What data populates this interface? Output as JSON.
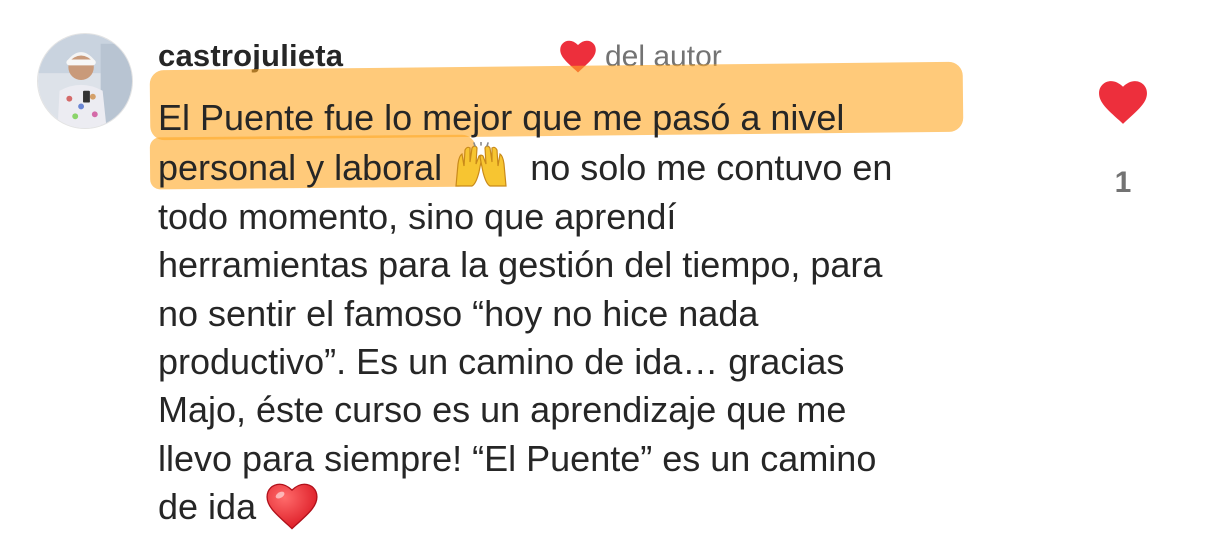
{
  "comment": {
    "username": "castrojulieta",
    "author_like_label": "del autor",
    "lines": [
      "El Puente fue lo mejor que me pasó a nivel",
      "personal y laboral",
      "no solo me contuvo en",
      "todo momento, sino que aprendí",
      "herramientas para la gestión del tiempo, para",
      "no sentir el famoso “hoy no hice nada",
      "productivo”. Es un camino de ida… gracias",
      "Majo, éste curso es un aprendizaje que me",
      "llevo para siempre! “El Puente” es un camino",
      "de ida"
    ],
    "emojis": [
      "raising-hands-emoji",
      "red-heart-emoji"
    ],
    "like_count": "1"
  },
  "colors": {
    "text": "#262626",
    "secondary": "#737373",
    "heart": "#ed2f3c",
    "highlight": "#ffaa28"
  },
  "icons": {
    "author_heart": "heart-icon",
    "like": "heart-icon"
  }
}
